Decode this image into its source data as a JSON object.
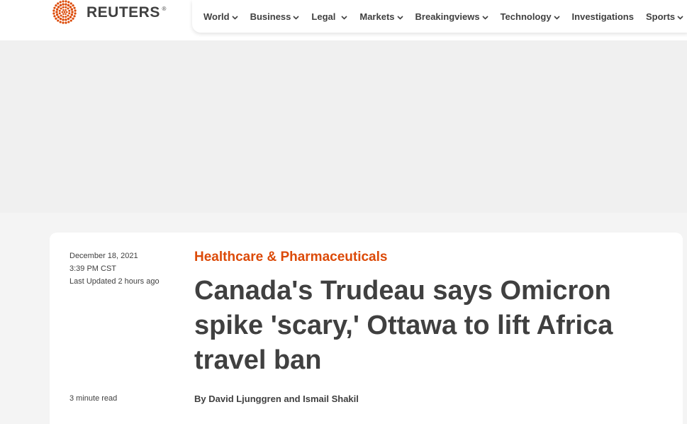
{
  "brand": {
    "name": "REUTERS",
    "registered": "®",
    "logo_icon": "reuters-dot-logo-icon",
    "accent_color": "#dc4a08"
  },
  "nav": {
    "items": [
      {
        "label": "World",
        "has_dropdown": true
      },
      {
        "label": "Business",
        "has_dropdown": true
      },
      {
        "label": "Legal",
        "has_dropdown": true
      },
      {
        "label": "Markets",
        "has_dropdown": true
      },
      {
        "label": "Breakingviews",
        "has_dropdown": true
      },
      {
        "label": "Technology",
        "has_dropdown": true
      },
      {
        "label": "Investigations",
        "has_dropdown": false
      },
      {
        "label": "Sports",
        "has_dropdown": true
      }
    ],
    "dropdown_icon": "chevron-down-icon"
  },
  "article": {
    "date": "December 18, 2021",
    "time": "3:39 PM CST",
    "last_updated": "Last Updated 2 hours ago",
    "read_time": "3 minute read",
    "category": "Healthcare & Pharmaceuticals",
    "headline": "Canada's Trudeau says Omicron spike 'scary,' Ottawa to lift Africa travel ban",
    "byline": "By David Ljunggren and Ismail Shakil"
  }
}
